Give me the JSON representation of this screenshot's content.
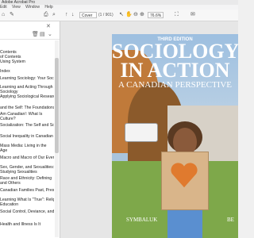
{
  "window": {
    "title": "Adobe Acrobat Pro"
  },
  "menu": [
    "Edit",
    "View",
    "Window",
    "Help"
  ],
  "toolbar": {
    "zoom": "76.6%",
    "page": "Cover",
    "page_count": "(1 / 901)"
  },
  "sidebar": {
    "items": [
      "Contents",
      "of Contents",
      "Using System",
      "Index",
      "Learning Sociology: Your Sociological",
      "Learning and Acting Through the",
      "Sociology",
      "Applying Sociological Research",
      "and the Self: The Foundations",
      "Am Canadian!: What Is",
      "Culture?",
      "Socialization: The Self and Social",
      "Social Inequality in Canadian",
      "Mass Media: Living in the",
      "Age",
      "Macro and Macro of Our Everyday",
      "Sex, Gender, and Sexualities:",
      "Studying Sexualities",
      "Race and Ethnicity: Defining",
      "and Others",
      "Canadian Families Past, Present,",
      "Learning What Is \"True\": Religion,",
      "Education",
      "Social Control, Deviance, and",
      "Health and Illness Is It"
    ]
  },
  "cover": {
    "edition": "THIRD EDITION",
    "title_line1": "SOCIOLOGY",
    "title_line2": "IN ACTION",
    "subtitle": "A CANADIAN PERSPECTIVE",
    "author_left": "SYMBALUK",
    "author_right": "BE"
  },
  "colors": {
    "accent_orange": "#e06b1d",
    "sign_cardboard": "#d9b58a",
    "heart": "#e07a2e"
  }
}
